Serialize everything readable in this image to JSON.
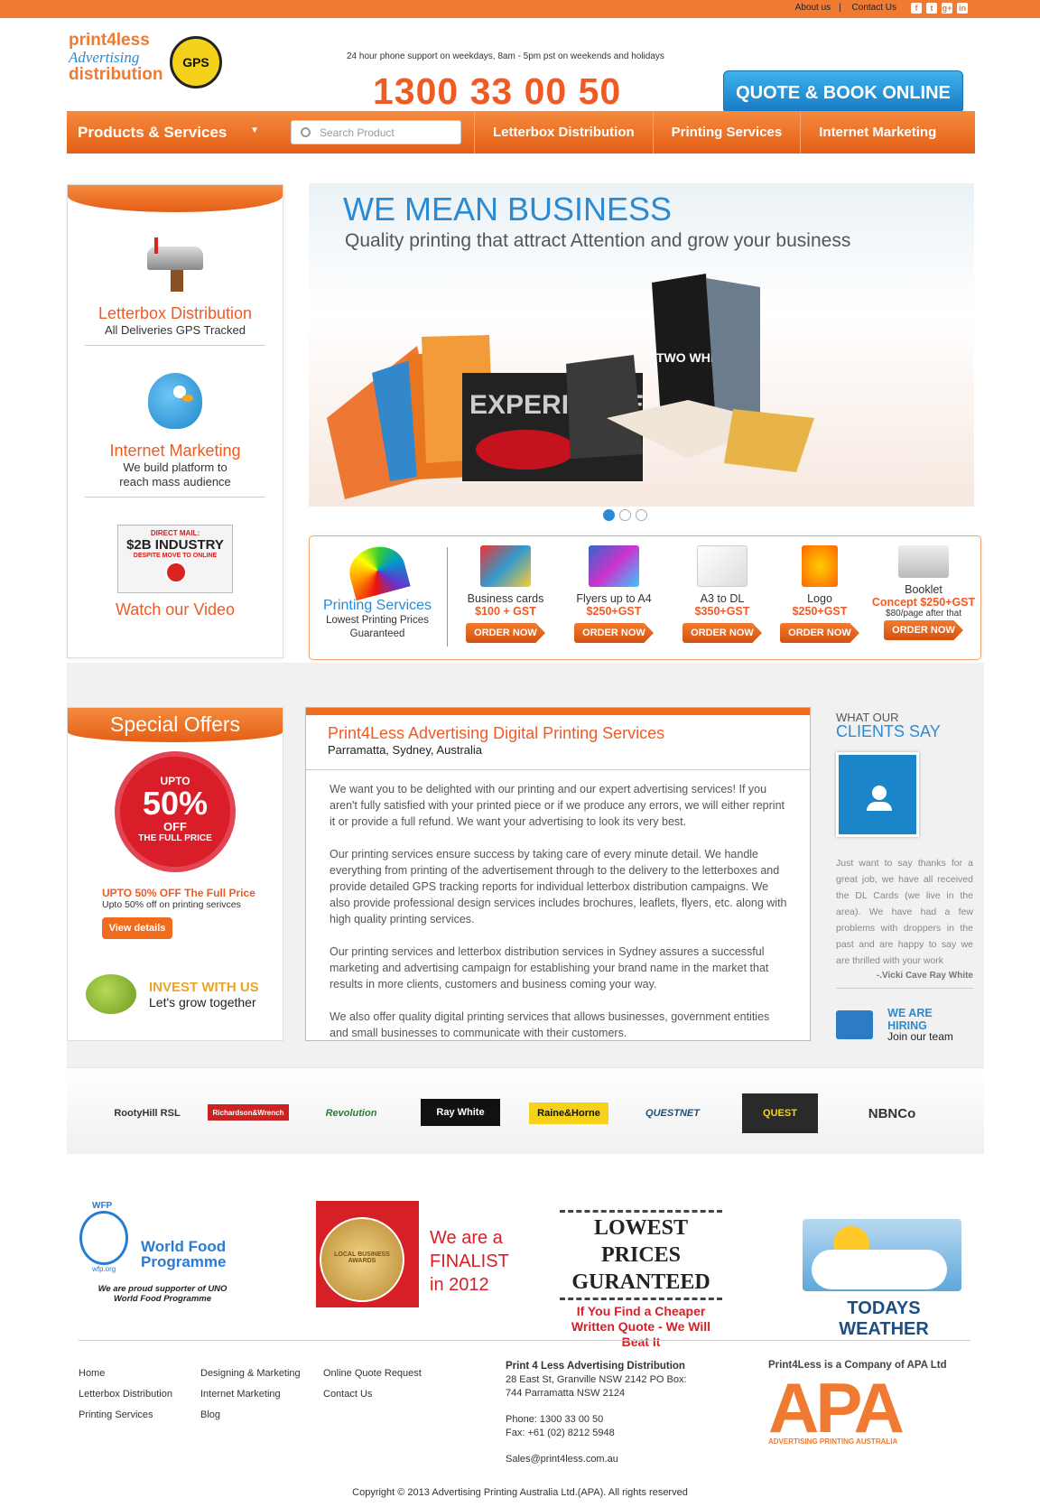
{
  "topbar": {
    "about": "About us",
    "contact": "Contact Us",
    "social": [
      "f",
      "t",
      "g+",
      "in"
    ]
  },
  "brand": {
    "l1": "print4less",
    "l2": "Advertising",
    "l3": "distribution",
    "badge": "GPS"
  },
  "header": {
    "support": "24 hour phone support on weekdays, 8am - 5pm pst on weekends and holidays",
    "phone": "1300 33 00 50",
    "quote_button": "QUOTE & BOOK ONLINE"
  },
  "nav": {
    "products": "Products & Services",
    "search_placeholder": "Search Product",
    "items": [
      "Letterbox Distribution",
      "Printing Services",
      "Internet Marketing"
    ]
  },
  "sidebar": {
    "letterbox_title": "Letterbox Distribution",
    "letterbox_sub": "All Deliveries GPS Tracked",
    "internet_title": "Internet Marketing",
    "internet_sub": "We build platform to reach mass audience",
    "video_t1": "DIRECT MAIL:",
    "video_t2": "$2B INDUSTRY",
    "video_t3": "DESPITE MOVE TO ONLINE",
    "video_title": "Watch our Video"
  },
  "hero": {
    "title": "WE MEAN BUSINESS",
    "subtitle": "Quality printing that attract Attention and grow your business",
    "slide_text": "EXPERIENCE",
    "slide_text2": "TWO WHEELS"
  },
  "printing": {
    "title": "Printing Services",
    "sub": "Lowest Printing Prices Guaranteed",
    "items": [
      {
        "name": "Business cards",
        "price": "$100 + GST",
        "extra": ""
      },
      {
        "name": "Flyers up to A4",
        "price": "$250+GST",
        "extra": ""
      },
      {
        "name": "A3 to DL",
        "price": "$350+GST",
        "extra": ""
      },
      {
        "name": "Logo",
        "price": "$250+GST",
        "extra": ""
      },
      {
        "name": "Booklet",
        "price": "Concept $250+GST",
        "extra": "$80/page after that"
      }
    ],
    "order_label": "ORDER NOW"
  },
  "special": {
    "title": "Special Offers",
    "b1": "UPTO",
    "b2": "50%",
    "b3": "OFF",
    "b4": "THE FULL PRICE",
    "offer_title": "UPTO 50% OFF The Full Price",
    "offer_sub": "Upto 50% off on printing serivces",
    "button": "View details",
    "invest_title": "INVEST WITH US",
    "invest_sub": "Let's grow together"
  },
  "about": {
    "title": "Print4Less Advertising Digital Printing Services",
    "location": "Parramatta, Sydney, Australia",
    "paras": [
      "We want you to be delighted with our printing and our expert advertising services! If you aren't fully satisfied with your printed piece or if we produce any errors, we will either reprint it or provide a full refund. We want your advertising to look its very best.",
      "Our printing services ensure success by taking care of every minute detail. We handle everything from printing of the advertisement through to the delivery to the letterboxes and provide detailed GPS tracking reports for individual letterbox distribution campaigns. We also provide professional design services includes brochures, leaflets, flyers, etc. along with high quality printing services.",
      "Our printing services and letterbox distribution services in Sydney assures a successful marketing and advertising campaign for establishing your brand name in the market that results in more clients, customers and business coming your way.",
      "We also offer quality digital printing services that allows businesses, government entities and small businesses to communicate with their customers."
    ]
  },
  "clients": {
    "a": "WHAT OUR",
    "b": "CLIENTS SAY",
    "quote": "Just want to say thanks for a great job, we have all received the DL Cards (we live in the area). We have had a few problems with droppers in the past and are happy to say we are thrilled with your work",
    "by": "-.Vicki Cave Ray White",
    "hiring": "WE ARE HIRING",
    "hiring_sub": "Join our team"
  },
  "partners": [
    "RootyHill RSL",
    "Richardson&Wrench",
    "Revolution",
    "Ray White",
    "Raine&Horne",
    "QUESTNET",
    "QUEST",
    "NBNCo"
  ],
  "badges": {
    "wfp_small": "WFP",
    "wfp_title": "World Food Programme",
    "wfp_url": "wfp.org",
    "wfp_sub": "We are proud supporter of UNO World Food Programme",
    "award_medal": "LOCAL BUSINESS AWARDS",
    "award_line1": "We are a",
    "award_line2": "FINALIST",
    "award_line3": "in 2012",
    "lp1": "LOWEST PRICES",
    "lp2": "GURANTEED",
    "lp3": "If You Find a Cheaper",
    "lp4": "Written Quote - We Will Beat It",
    "weather": "TODAYS WEATHER"
  },
  "footer": {
    "col1": [
      "Home",
      "Letterbox Distribution",
      "Printing Services"
    ],
    "col2": [
      "Designing & Marketing",
      "Internet Marketing",
      "Blog"
    ],
    "col3": [
      "Online Quote Request",
      "Contact Us"
    ],
    "addr_title": "Print 4 Less Advertising Distribution",
    "addr1": "28 East St, Granville NSW 2142 PO Box:",
    "addr2": "744 Parramatta NSW 2124",
    "phone": "Phone: 1300 33 00 50",
    "fax": "Fax: +61 (02) 8212 5948",
    "email": "Sales@print4less.com.au",
    "apa_title": "Print4Less is a Company of APA Ltd",
    "apa_logo": "APA",
    "apa_sub": "ADVERTISING PRINTING AUSTRALIA",
    "copyright": "Copyright © 2013 Advertising Printing Australia Ltd.(APA). All rights reserved"
  }
}
